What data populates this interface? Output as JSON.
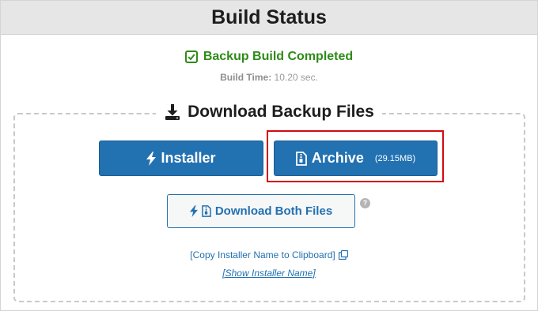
{
  "header": {
    "title": "Build Status"
  },
  "status": {
    "message": "Backup Build Completed",
    "build_time_label": "Build Time:",
    "build_time_value": "10.20 sec."
  },
  "downloads": {
    "section_title": "Download Backup Files",
    "installer_label": "Installer",
    "archive_label": "Archive",
    "archive_size": "(29.15MB)",
    "both_label": "Download Both Files",
    "help_glyph": "?",
    "copy_link": "[Copy Installer Name to Clipboard]",
    "show_link": "[Show Installer Name]"
  },
  "icons": {
    "check": "check-square-icon",
    "download": "download-icon",
    "bolt": "bolt-icon",
    "archive": "file-archive-icon",
    "copy": "copy-icon",
    "help": "help-icon"
  },
  "colors": {
    "primary": "#2271b1",
    "success": "#2e8b18",
    "highlight": "#d20a11"
  }
}
